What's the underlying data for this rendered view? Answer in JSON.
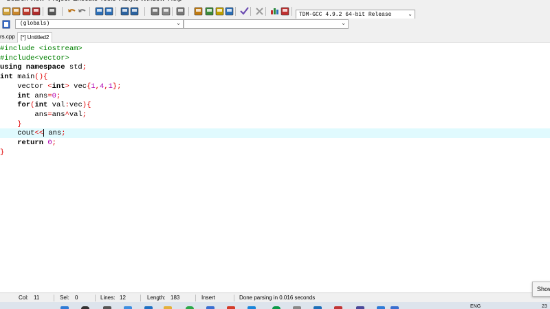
{
  "menu": [
    "Search",
    "View",
    "Project",
    "Execute",
    "Tools",
    "AStyle",
    "Window",
    "Help"
  ],
  "toolbar": {
    "compiler": "TDM-GCC 4.9.2 64-bit Release"
  },
  "toolbar2": {
    "scope": "(globals)",
    "member": ""
  },
  "tabs": [
    {
      "label": "rs.cpp",
      "active": false
    },
    {
      "label": "[*] Untitled2",
      "active": true
    }
  ],
  "editor": {
    "current_line": 9,
    "lines": [
      [
        {
          "t": "#include <iostream>",
          "c": "pp"
        }
      ],
      [
        {
          "t": "#include<vector>",
          "c": "pp"
        }
      ],
      [
        {
          "t": "using namespace",
          "c": "kw"
        },
        {
          "t": " std",
          "c": "tx"
        },
        {
          "t": ";",
          "c": "op"
        }
      ],
      [
        {
          "t": "int",
          "c": "kw"
        },
        {
          "t": " main",
          "c": "tx"
        },
        {
          "t": "(){",
          "c": "br"
        }
      ],
      [
        {
          "t": "    vector ",
          "c": "tx"
        },
        {
          "t": "<",
          "c": "op"
        },
        {
          "t": "int",
          "c": "kw"
        },
        {
          "t": "> ",
          "c": "op"
        },
        {
          "t": "vec",
          "c": "tx"
        },
        {
          "t": "{",
          "c": "br"
        },
        {
          "t": "1",
          "c": "nm"
        },
        {
          "t": ",",
          "c": "op"
        },
        {
          "t": "4",
          "c": "nm"
        },
        {
          "t": ",",
          "c": "op"
        },
        {
          "t": "1",
          "c": "nm"
        },
        {
          "t": "};",
          "c": "br"
        }
      ],
      [
        {
          "t": "    ",
          "c": "tx"
        },
        {
          "t": "int",
          "c": "kw"
        },
        {
          "t": " ans",
          "c": "tx"
        },
        {
          "t": "=",
          "c": "op"
        },
        {
          "t": "0",
          "c": "nm"
        },
        {
          "t": ";",
          "c": "op"
        }
      ],
      [
        {
          "t": "    ",
          "c": "tx"
        },
        {
          "t": "for",
          "c": "kw"
        },
        {
          "t": "(",
          "c": "br"
        },
        {
          "t": "int",
          "c": "kw"
        },
        {
          "t": " val",
          "c": "tx"
        },
        {
          "t": ":",
          "c": "op"
        },
        {
          "t": "vec",
          "c": "tx"
        },
        {
          "t": "){",
          "c": "br"
        }
      ],
      [
        {
          "t": "        ans",
          "c": "tx"
        },
        {
          "t": "=",
          "c": "op"
        },
        {
          "t": "ans",
          "c": "tx"
        },
        {
          "t": "^",
          "c": "op"
        },
        {
          "t": "val",
          "c": "tx"
        },
        {
          "t": ";",
          "c": "op"
        }
      ],
      [
        {
          "t": "    ",
          "c": "tx"
        },
        {
          "t": "}",
          "c": "br"
        }
      ],
      [
        {
          "t": "    cout",
          "c": "tx"
        },
        {
          "t": "<<",
          "c": "op"
        },
        {
          "t": "|",
          "c": "caret"
        },
        {
          "t": " ans",
          "c": "tx"
        },
        {
          "t": ";",
          "c": "op"
        }
      ],
      [
        {
          "t": "    ",
          "c": "tx"
        },
        {
          "t": "return",
          "c": "kw"
        },
        {
          "t": " ",
          "c": "tx"
        },
        {
          "t": "0",
          "c": "nm"
        },
        {
          "t": ";",
          "c": "op"
        }
      ],
      [
        {
          "t": "}",
          "c": "br"
        }
      ]
    ]
  },
  "status": {
    "col_label": "Col:",
    "col_value": "11",
    "sel_label": "Sel:",
    "sel_value": "0",
    "lines_label": "Lines:",
    "lines_value": "12",
    "length_label": "Length:",
    "length_value": "183",
    "mode": "Insert",
    "message": "Done parsing in 0.016 seconds"
  },
  "tooltip": "Show",
  "taskbar": {
    "lang": "ENG",
    "clock": "23"
  },
  "icons": {
    "toolbar": [
      "save-icon",
      "save-all-icon",
      "close-file-icon",
      "close-all-icon",
      "print-icon",
      "undo-icon",
      "redo-icon",
      "find-icon",
      "replace-icon",
      "compile-icon",
      "compile-run-icon",
      "indent-icon",
      "unindent-icon",
      "bookmark-icon",
      "new-class-icon",
      "new-project-icon",
      "insert-icon",
      "goto-icon",
      "check-icon",
      "stop-icon",
      "chart-icon",
      "profile-icon"
    ]
  }
}
